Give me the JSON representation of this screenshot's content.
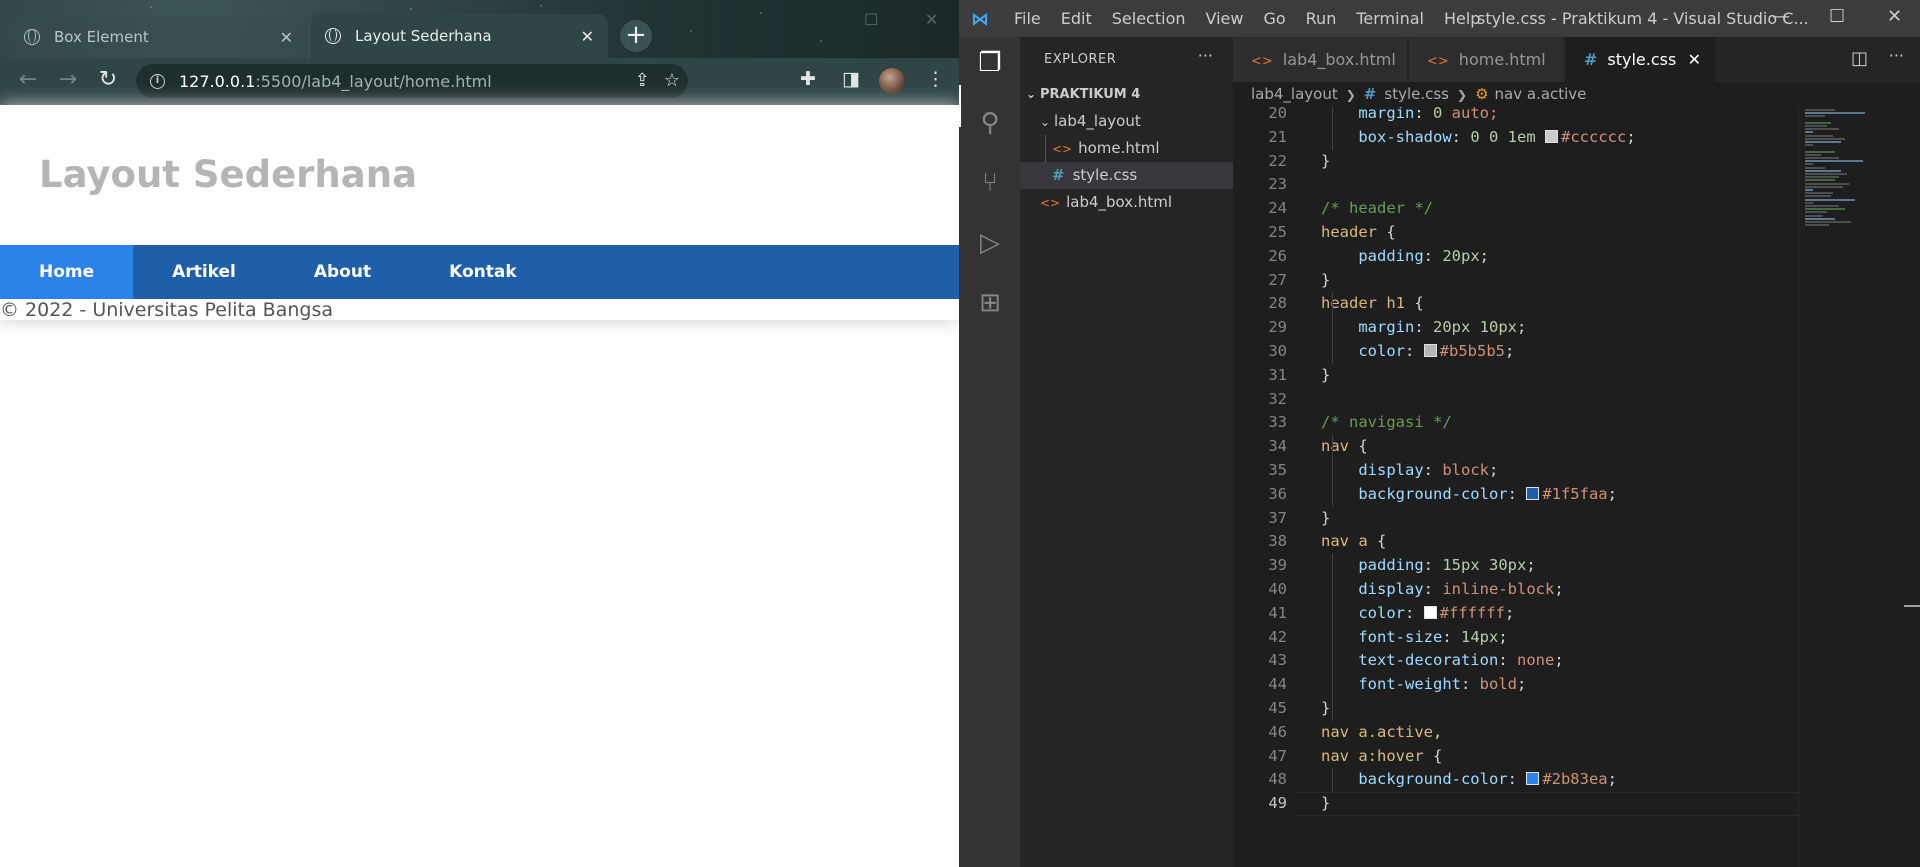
{
  "browser": {
    "tabs": [
      {
        "title": "Box Element",
        "active": false
      },
      {
        "title": "Layout Sederhana",
        "active": true
      }
    ],
    "url_host": "127.0.0.1",
    "url_path": ":5500/lab4_layout/home.html"
  },
  "site": {
    "heading": "Layout Sederhana",
    "heading_color": "#b5b5b5",
    "nav_color": "#1f5faa",
    "nav_active_color": "#2b83ea",
    "nav": [
      {
        "label": "Home",
        "active": true
      },
      {
        "label": "Artikel",
        "active": false
      },
      {
        "label": "About",
        "active": false
      },
      {
        "label": "Kontak",
        "active": false
      }
    ],
    "footer": "© 2022 - Universitas Pelita Bangsa"
  },
  "vscode": {
    "menu": [
      "File",
      "Edit",
      "Selection",
      "View",
      "Go",
      "Run",
      "Terminal",
      "Help"
    ],
    "window_title": "style.css - Praktikum 4 - Visual Studio C...",
    "explorer_title": "EXPLORER",
    "workspace": "PRAKTIKUM 4",
    "tree": {
      "folder": "lab4_layout",
      "folder_files": [
        "home.html",
        "style.css"
      ],
      "root_files": [
        "lab4_box.html"
      ]
    },
    "tabs": [
      {
        "name": "lab4_box.html",
        "kind": "html",
        "active": false
      },
      {
        "name": "home.html",
        "kind": "html",
        "active": false
      },
      {
        "name": "style.css",
        "kind": "css",
        "active": true
      }
    ],
    "breadcrumb": {
      "folder": "lab4_layout",
      "file": "style.css",
      "symbol": "nav a.active"
    },
    "current_line": 49,
    "code_lines": [
      {
        "n": 20,
        "parts": [
          [
            "    ",
            "pun"
          ],
          [
            "margin",
            "prop"
          ],
          [
            ": ",
            "pun"
          ],
          [
            "0",
            "num"
          ],
          [
            " auto;",
            "val"
          ]
        ]
      },
      {
        "n": 21,
        "parts": [
          [
            "    ",
            "pun"
          ],
          [
            "box-shadow",
            "prop"
          ],
          [
            ": ",
            "pun"
          ],
          [
            "0 0 1em",
            "num"
          ],
          [
            " ",
            "pun"
          ],
          [
            "#cccccc",
            "swatch"
          ],
          [
            "#cccccc",
            "val"
          ],
          [
            ";",
            "pun"
          ]
        ]
      },
      {
        "n": 22,
        "parts": [
          [
            "}",
            "pun"
          ]
        ]
      },
      {
        "n": 23,
        "parts": []
      },
      {
        "n": 24,
        "parts": [
          [
            "/* header */",
            "com"
          ]
        ]
      },
      {
        "n": 25,
        "parts": [
          [
            "header",
            "sel"
          ],
          [
            " {",
            "pun"
          ]
        ]
      },
      {
        "n": 26,
        "parts": [
          [
            "    ",
            "pun"
          ],
          [
            "padding",
            "prop"
          ],
          [
            ": ",
            "pun"
          ],
          [
            "20px",
            "num"
          ],
          [
            ";",
            "pun"
          ]
        ]
      },
      {
        "n": 27,
        "parts": [
          [
            "}",
            "pun"
          ]
        ]
      },
      {
        "n": 28,
        "parts": [
          [
            "header h1",
            "sel"
          ],
          [
            " {",
            "pun"
          ]
        ]
      },
      {
        "n": 29,
        "parts": [
          [
            "    ",
            "pun"
          ],
          [
            "margin",
            "prop"
          ],
          [
            ": ",
            "pun"
          ],
          [
            "20px 10px",
            "num"
          ],
          [
            ";",
            "pun"
          ]
        ]
      },
      {
        "n": 30,
        "parts": [
          [
            "    ",
            "pun"
          ],
          [
            "color",
            "prop"
          ],
          [
            ": ",
            "pun"
          ],
          [
            "#b5b5b5",
            "swatch"
          ],
          [
            "#b5b5b5",
            "val"
          ],
          [
            ";",
            "pun"
          ]
        ]
      },
      {
        "n": 31,
        "parts": [
          [
            "}",
            "pun"
          ]
        ]
      },
      {
        "n": 32,
        "parts": []
      },
      {
        "n": 33,
        "parts": [
          [
            "/* navigasi */",
            "com"
          ]
        ]
      },
      {
        "n": 34,
        "parts": [
          [
            "nav",
            "sel"
          ],
          [
            " {",
            "pun"
          ]
        ]
      },
      {
        "n": 35,
        "parts": [
          [
            "    ",
            "pun"
          ],
          [
            "display",
            "prop"
          ],
          [
            ": ",
            "pun"
          ],
          [
            "block",
            "val"
          ],
          [
            ";",
            "pun"
          ]
        ]
      },
      {
        "n": 36,
        "parts": [
          [
            "    ",
            "pun"
          ],
          [
            "background-color",
            "prop"
          ],
          [
            ": ",
            "pun"
          ],
          [
            "#1f5faa",
            "swatch"
          ],
          [
            "#1f5faa",
            "val"
          ],
          [
            ";",
            "pun"
          ]
        ]
      },
      {
        "n": 37,
        "parts": [
          [
            "}",
            "pun"
          ]
        ]
      },
      {
        "n": 38,
        "parts": [
          [
            "nav a",
            "sel"
          ],
          [
            " {",
            "pun"
          ]
        ]
      },
      {
        "n": 39,
        "parts": [
          [
            "    ",
            "pun"
          ],
          [
            "padding",
            "prop"
          ],
          [
            ": ",
            "pun"
          ],
          [
            "15px 30px",
            "num"
          ],
          [
            ";",
            "pun"
          ]
        ]
      },
      {
        "n": 40,
        "parts": [
          [
            "    ",
            "pun"
          ],
          [
            "display",
            "prop"
          ],
          [
            ": ",
            "pun"
          ],
          [
            "inline-block",
            "val"
          ],
          [
            ";",
            "pun"
          ]
        ]
      },
      {
        "n": 41,
        "parts": [
          [
            "    ",
            "pun"
          ],
          [
            "color",
            "prop"
          ],
          [
            ": ",
            "pun"
          ],
          [
            "#ffffff",
            "swatch"
          ],
          [
            "#ffffff",
            "val"
          ],
          [
            ";",
            "pun"
          ]
        ]
      },
      {
        "n": 42,
        "parts": [
          [
            "    ",
            "pun"
          ],
          [
            "font-size",
            "prop"
          ],
          [
            ": ",
            "pun"
          ],
          [
            "14px",
            "num"
          ],
          [
            ";",
            "pun"
          ]
        ]
      },
      {
        "n": 43,
        "parts": [
          [
            "    ",
            "pun"
          ],
          [
            "text-decoration",
            "prop"
          ],
          [
            ": ",
            "pun"
          ],
          [
            "none",
            "val"
          ],
          [
            ";",
            "pun"
          ]
        ]
      },
      {
        "n": 44,
        "parts": [
          [
            "    ",
            "pun"
          ],
          [
            "font-weight",
            "prop"
          ],
          [
            ": ",
            "pun"
          ],
          [
            "bold",
            "val"
          ],
          [
            ";",
            "pun"
          ]
        ]
      },
      {
        "n": 45,
        "parts": [
          [
            "}",
            "pun"
          ]
        ]
      },
      {
        "n": 46,
        "parts": [
          [
            "nav a.active",
            "sel"
          ],
          [
            ",",
            "pun"
          ]
        ]
      },
      {
        "n": 47,
        "parts": [
          [
            "nav a:hover",
            "sel"
          ],
          [
            " {",
            "pun"
          ]
        ]
      },
      {
        "n": 48,
        "parts": [
          [
            "    ",
            "pun"
          ],
          [
            "background-color",
            "prop"
          ],
          [
            ": ",
            "pun"
          ],
          [
            "#2b83ea",
            "swatch"
          ],
          [
            "#2b83ea",
            "val"
          ],
          [
            ";",
            "pun"
          ]
        ]
      },
      {
        "n": 49,
        "parts": [
          [
            "}",
            "pun"
          ]
        ]
      }
    ]
  }
}
